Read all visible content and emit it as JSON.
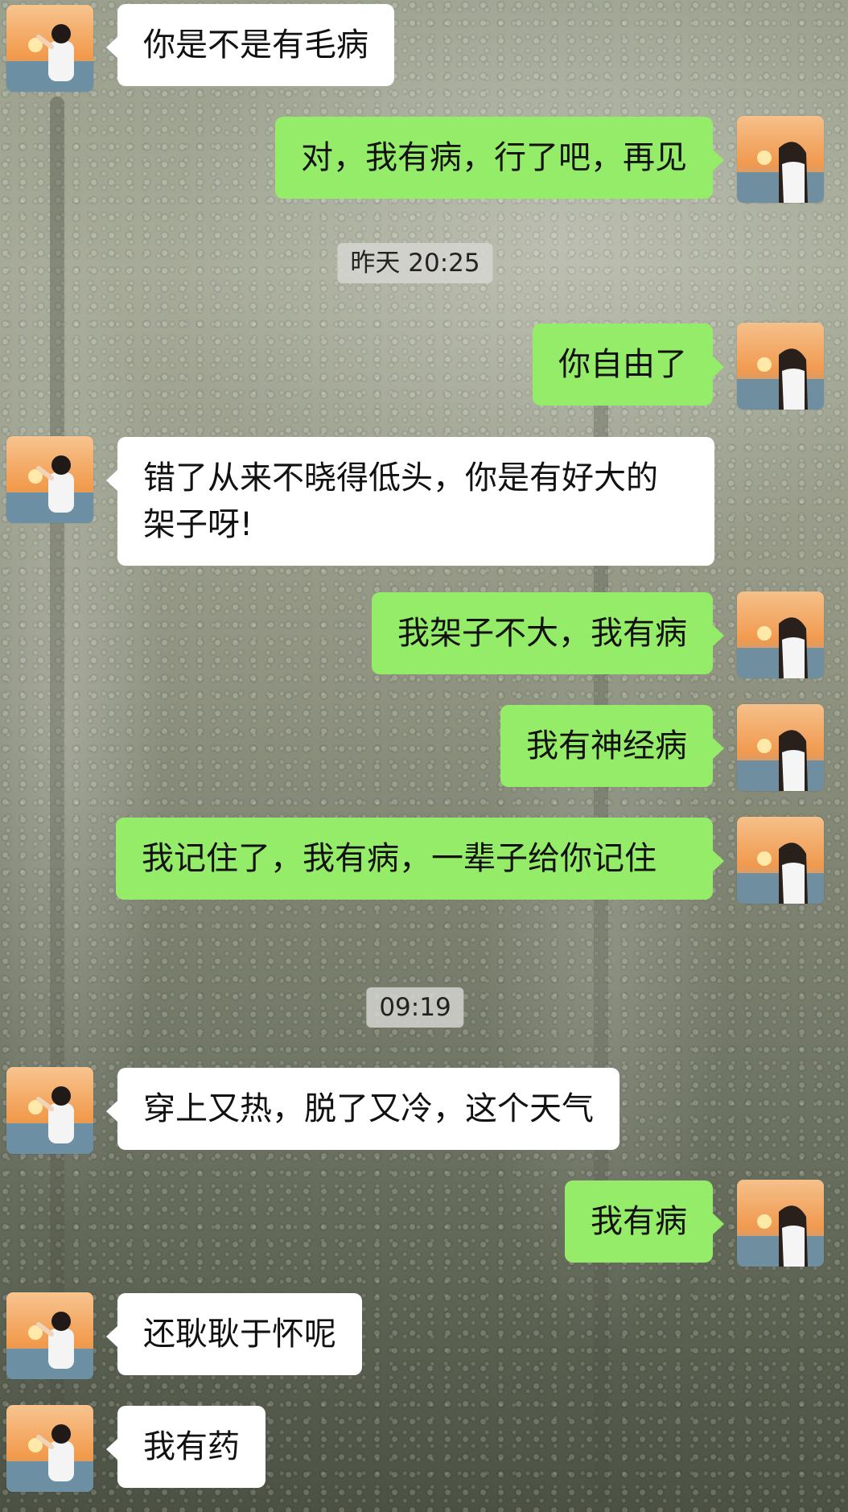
{
  "messages": [
    {
      "side": "in",
      "text": "你是不是有毛病"
    },
    {
      "side": "out",
      "text": "对，我有病，行了吧，再见"
    },
    {
      "timestamp": "昨天 20:25"
    },
    {
      "side": "out",
      "text": "你自由了"
    },
    {
      "side": "in",
      "text": "错了从来不晓得低头，你是有好大的架子呀!"
    },
    {
      "side": "out",
      "text": "我架子不大，我有病"
    },
    {
      "side": "out",
      "text": "我有神经病"
    },
    {
      "side": "out",
      "text": "我记住了，我有病，一辈子给你记住"
    },
    {
      "timestamp": "09:19"
    },
    {
      "side": "in",
      "text": "穿上又热，脱了又冷，这个天气"
    },
    {
      "side": "out",
      "text": "我有病"
    },
    {
      "side": "in",
      "text": "还耿耿于怀呢"
    },
    {
      "side": "in",
      "text": "我有药"
    }
  ],
  "colors": {
    "incoming_bubble": "#ffffff",
    "outgoing_bubble": "#95ec69"
  },
  "icons": {
    "incoming_avatar": "avatar-boy-sunset-icon",
    "outgoing_avatar": "avatar-girl-sunset-icon"
  }
}
